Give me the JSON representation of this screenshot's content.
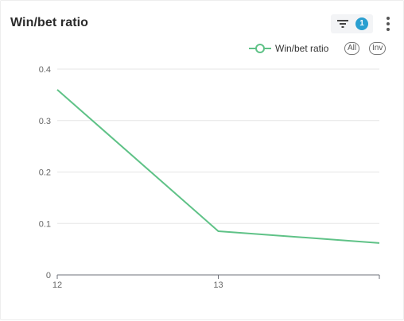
{
  "card": {
    "title": "Win/bet ratio",
    "filter": {
      "icon": "filter-icon",
      "badge_count": "1"
    },
    "menu": {
      "icon": "more-vertical-icon"
    }
  },
  "legend": {
    "series_label": "Win/bet ratio",
    "all_label": "All",
    "inv_label": "Inv"
  },
  "colors": {
    "series": "#5fc287",
    "badge": "#2a9fd0",
    "grid": "#e6e6e6",
    "axis": "#6e7079"
  },
  "chart_data": {
    "type": "line",
    "title": "Win/bet ratio",
    "x": [
      "12",
      "13",
      ""
    ],
    "x_tick_labels": [
      "12",
      "13"
    ],
    "series": [
      {
        "name": "Win/bet ratio",
        "values": [
          0.36,
          0.085,
          0.062
        ]
      }
    ],
    "ylim": [
      0,
      0.4
    ],
    "y_ticks": [
      "0",
      "0.1",
      "0.2",
      "0.3",
      "0.4"
    ],
    "xlabel": "",
    "ylabel": "",
    "grid": true,
    "legend_position": "top-right"
  }
}
